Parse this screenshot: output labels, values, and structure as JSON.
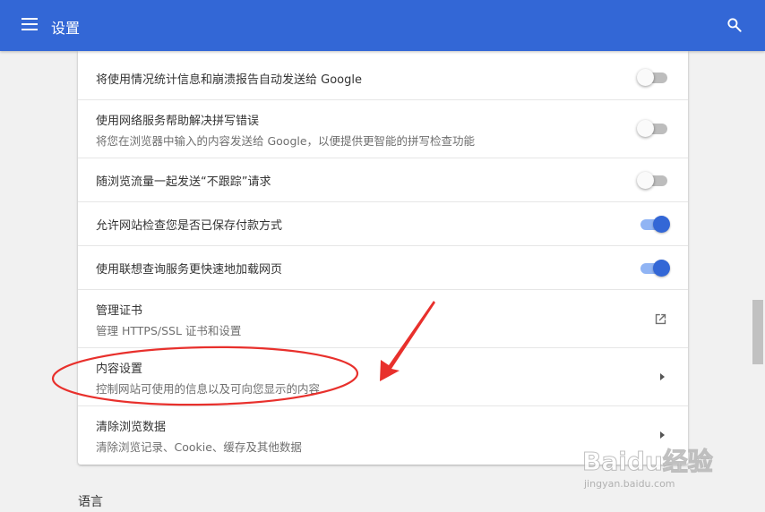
{
  "header": {
    "title": "设置",
    "menu_icon": "hamburger-menu-icon",
    "search_icon": "search-icon",
    "background_color": "#3367d6"
  },
  "settings": {
    "rows": [
      {
        "title": "将使用情况统计信息和崩溃报告自动发送给 Google",
        "subtitle": "",
        "control": "toggle",
        "checked": false
      },
      {
        "title": "使用网络服务帮助解决拼写错误",
        "subtitle": "将您在浏览器中输入的内容发送给 Google，以便提供更智能的拼写检查功能",
        "control": "toggle",
        "checked": false
      },
      {
        "title": "随浏览流量一起发送“不跟踪”请求",
        "subtitle": "",
        "control": "toggle",
        "checked": false
      },
      {
        "title": "允许网站检查您是否已保存付款方式",
        "subtitle": "",
        "control": "toggle",
        "checked": true
      },
      {
        "title": "使用联想查询服务更快速地加载网页",
        "subtitle": "",
        "control": "toggle",
        "checked": true
      },
      {
        "title": "管理证书",
        "subtitle": "管理 HTTPS/SSL 证书和设置",
        "control": "open-in-new-icon"
      },
      {
        "title": "内容设置",
        "subtitle": "控制网站可使用的信息以及可向您显示的内容",
        "control": "chevron-right-icon"
      },
      {
        "title": "清除浏览数据",
        "subtitle": "清除浏览记录、Cookie、缓存及其他数据",
        "control": "chevron-right-icon"
      }
    ]
  },
  "next_section": {
    "title": "语言"
  },
  "accent_color": "#3367d6",
  "annotation_color": "#e8302c",
  "watermark": {
    "main": "Baidu经验",
    "sub": "jingyan.baidu.com"
  }
}
